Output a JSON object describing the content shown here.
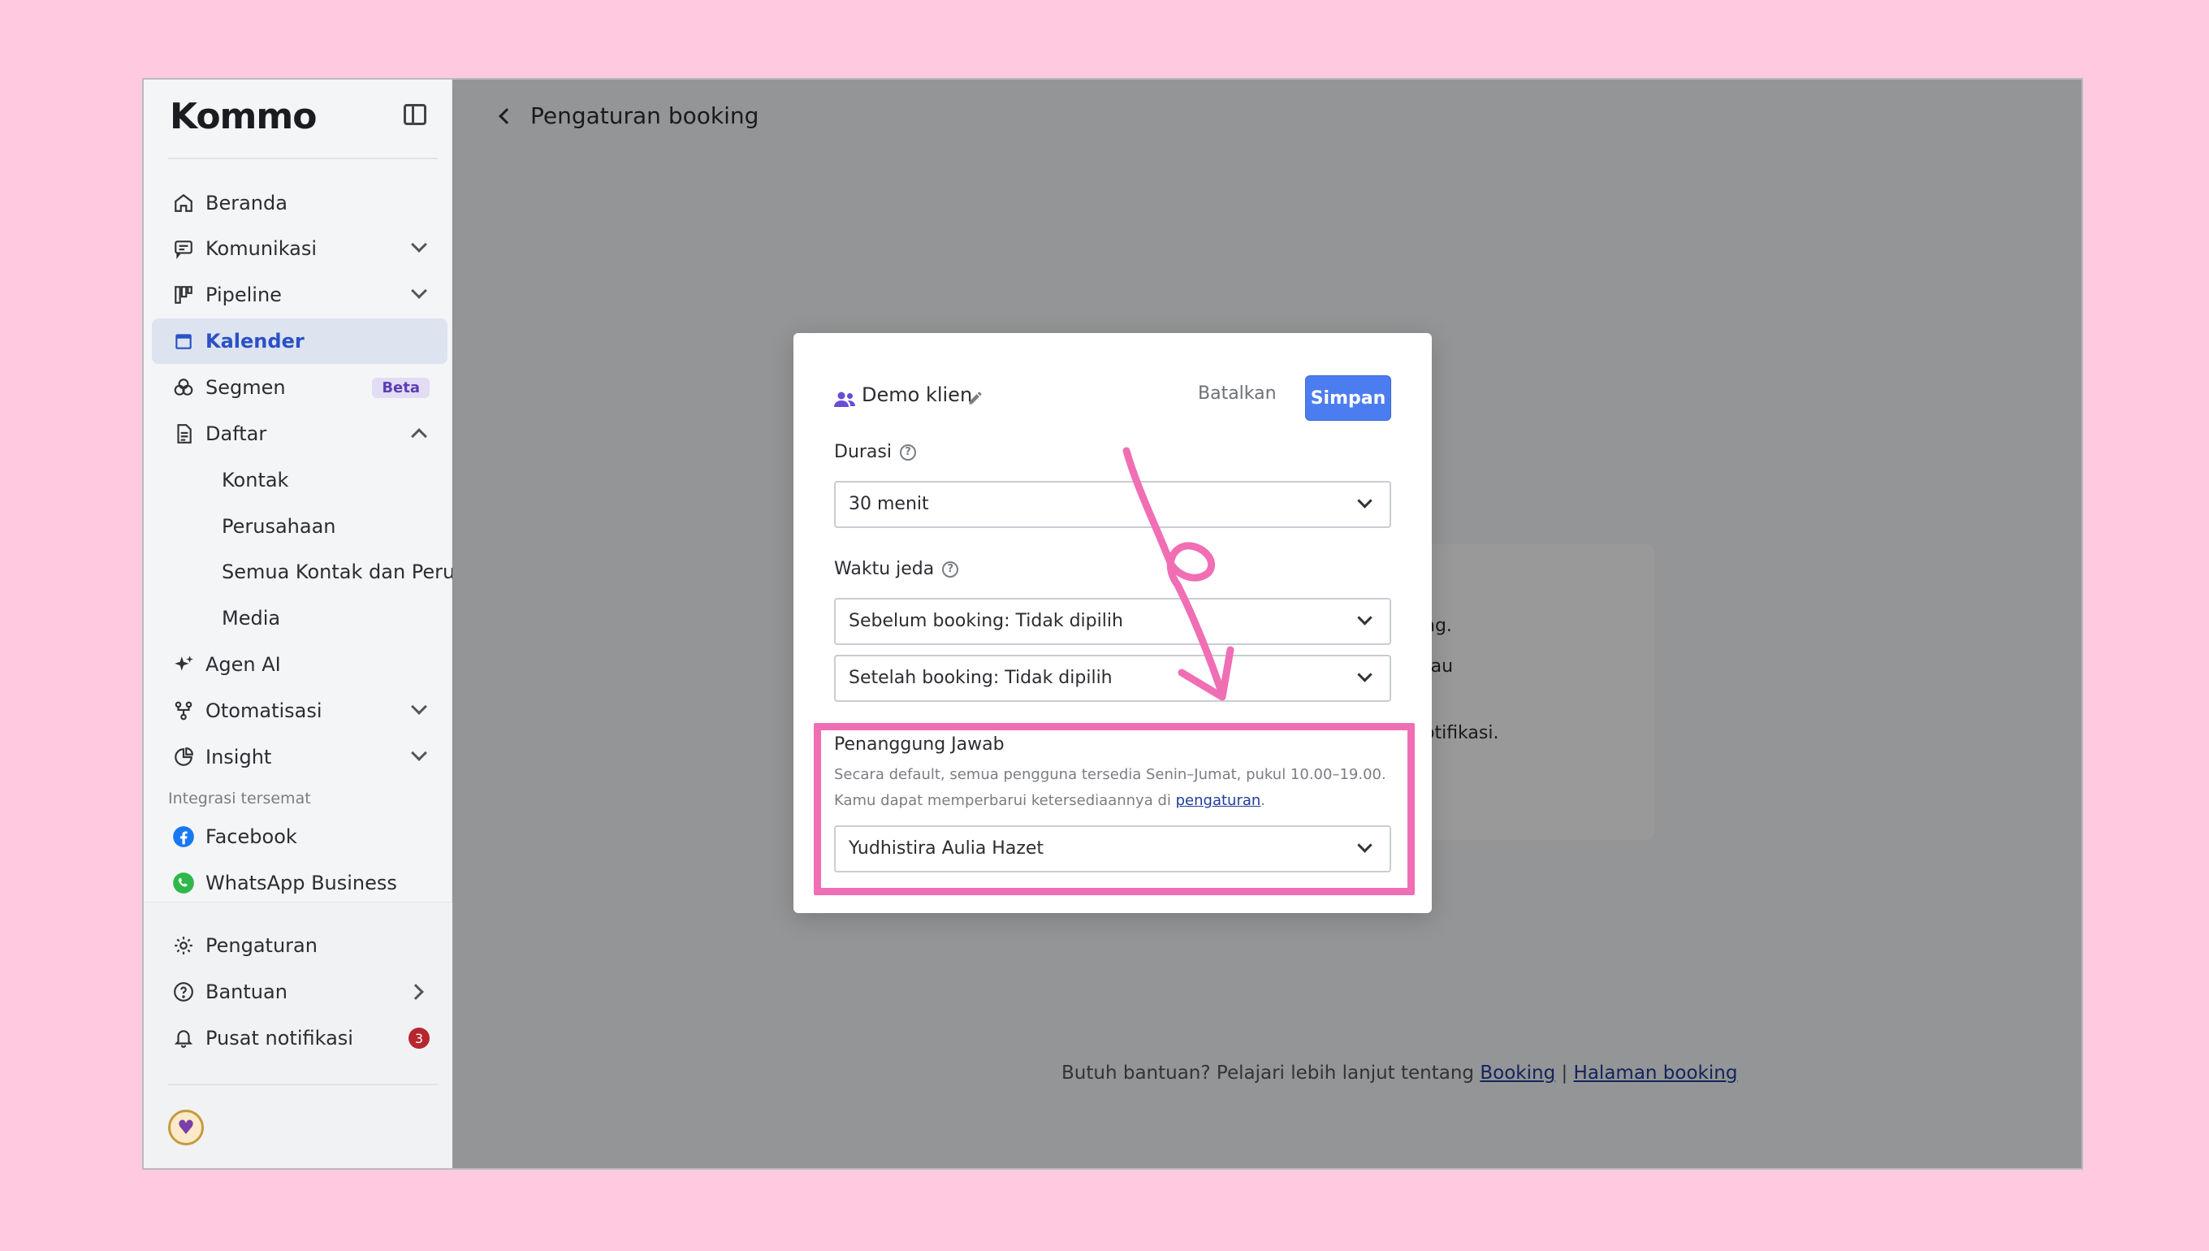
{
  "app": {
    "logo": "Kommo"
  },
  "sidebar": {
    "items": [
      {
        "label": "Beranda",
        "icon": "home-icon"
      },
      {
        "label": "Komunikasi",
        "icon": "chat-icon"
      },
      {
        "label": "Pipeline",
        "icon": "pipeline-icon"
      },
      {
        "label": "Kalender",
        "icon": "calendar-icon"
      },
      {
        "label": "Segmen",
        "icon": "segments-icon",
        "badge": "Beta"
      },
      {
        "label": "Daftar",
        "icon": "list-icon"
      },
      {
        "label": "Kontak"
      },
      {
        "label": "Perusahaan"
      },
      {
        "label": "Semua Kontak dan Peru..."
      },
      {
        "label": "Media"
      },
      {
        "label": "Agen AI",
        "icon": "sparkle-icon"
      },
      {
        "label": "Otomatisasi",
        "icon": "automation-icon"
      },
      {
        "label": "Insight",
        "icon": "chart-pie-icon"
      }
    ],
    "integrations_label": "Integrasi tersemat",
    "integrations": [
      {
        "label": "Facebook",
        "icon": "facebook-icon"
      },
      {
        "label": "WhatsApp Business",
        "icon": "whatsapp-icon"
      }
    ],
    "bottom": [
      {
        "label": "Pengaturan",
        "icon": "gear-icon"
      },
      {
        "label": "Bantuan",
        "icon": "help-icon"
      },
      {
        "label": "Pusat notifikasi",
        "icon": "bell-icon",
        "count": "3"
      }
    ]
  },
  "main": {
    "title": "Pengaturan booking",
    "bg_fragments": [
      "ng.",
      "tau",
      "otifikasi."
    ],
    "footer": {
      "text": "Butuh bantuan? Pelajari lebih lanjut tentang",
      "link1": "Booking",
      "sep": "|",
      "link2": "Halaman booking"
    }
  },
  "modal": {
    "title": "Demo klien",
    "cancel": "Batalkan",
    "save": "Simpan",
    "duration": {
      "label": "Durasi",
      "value": "30 menit"
    },
    "break_time": {
      "label": "Waktu jeda",
      "before": "Sebelum booking: Tidak dipilih",
      "after": "Setelah booking: Tidak dipilih"
    },
    "responsible": {
      "label": "Penanggung Jawab",
      "desc_line1": "Secara default, semua pengguna tersedia Senin–Jumat, pukul 10.00–19.00.",
      "desc_line2_pre": "Kamu dapat memperbarui ketersediaannya di",
      "desc_link": "pengaturan",
      "desc_end": ".",
      "value": "Yudhistira Aulia Hazet"
    }
  },
  "colors": {
    "accent": "#4c7df0",
    "highlight": "#f06eb4",
    "page_bg": "#ffc9e0"
  }
}
